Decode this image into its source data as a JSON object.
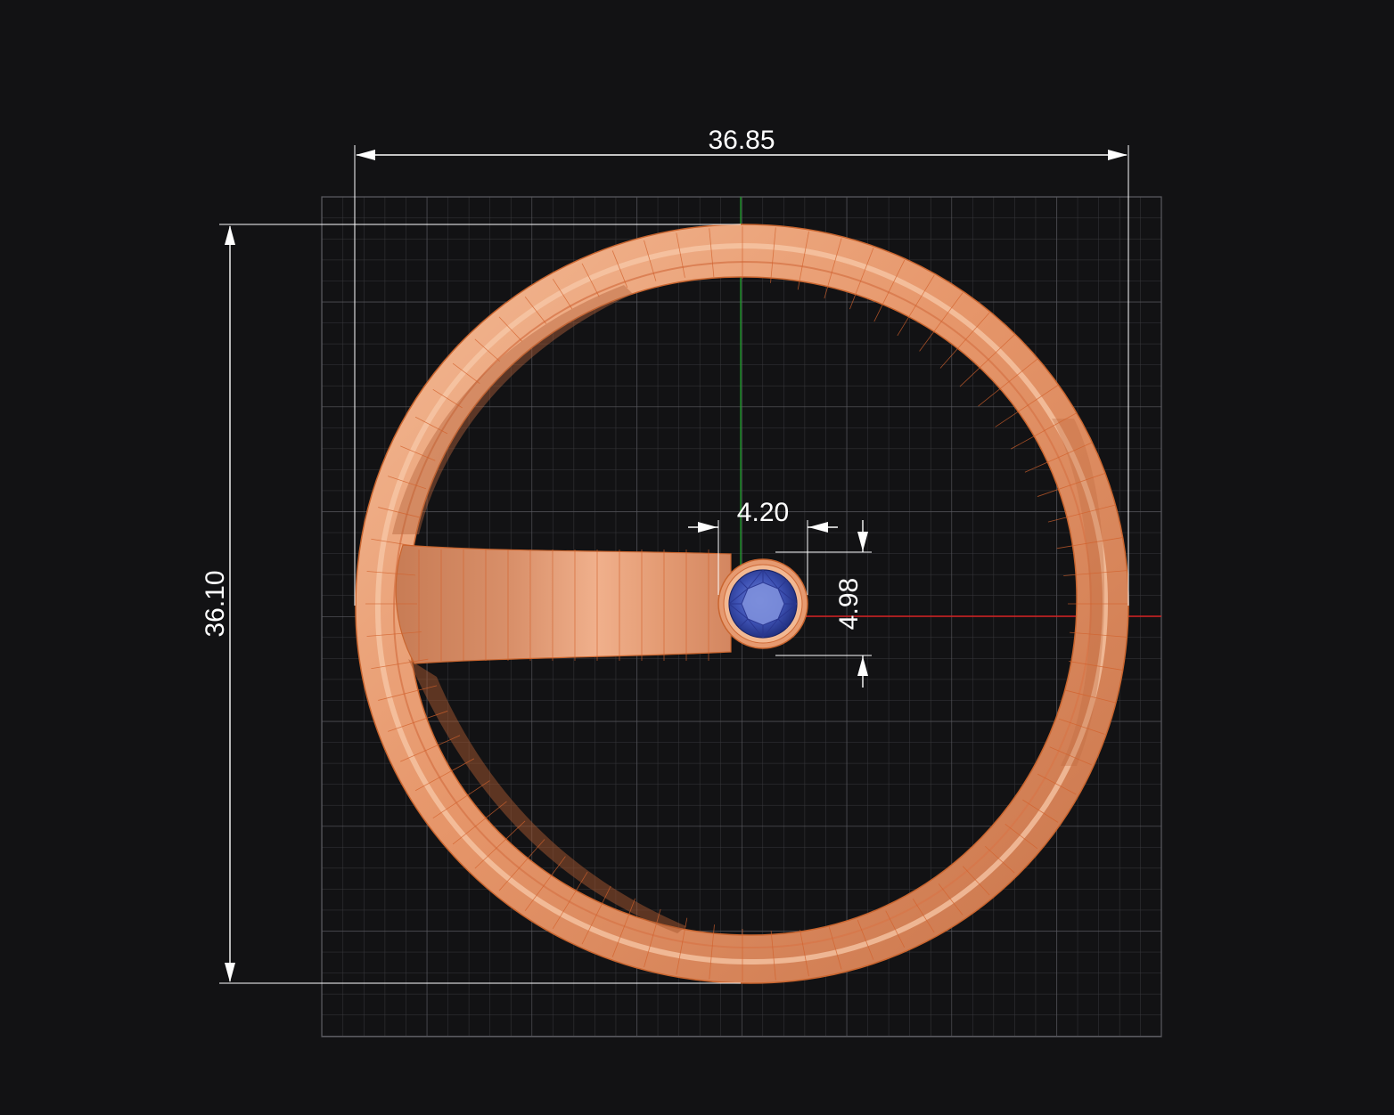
{
  "dimensions": {
    "overall_width": "36.85",
    "overall_height": "36.10",
    "stone_width": "4.20",
    "stone_height": "4.98"
  },
  "colors": {
    "background": "#121214",
    "grid_minor": "#3a3a3e",
    "grid_major": "#55555a",
    "axis_x": "#d42020",
    "axis_y": "#1f9a2a",
    "metal_light": "#f2b48e",
    "metal_mid": "#e08e62",
    "metal_dark": "#b9643c",
    "wire": "#d86a36",
    "gem": "#2e3f9e",
    "gem_light": "#6f82d8",
    "dimension": "#ffffff"
  },
  "icons": {
    "ring": "ring-band-icon",
    "gem": "round-gemstone-icon"
  }
}
